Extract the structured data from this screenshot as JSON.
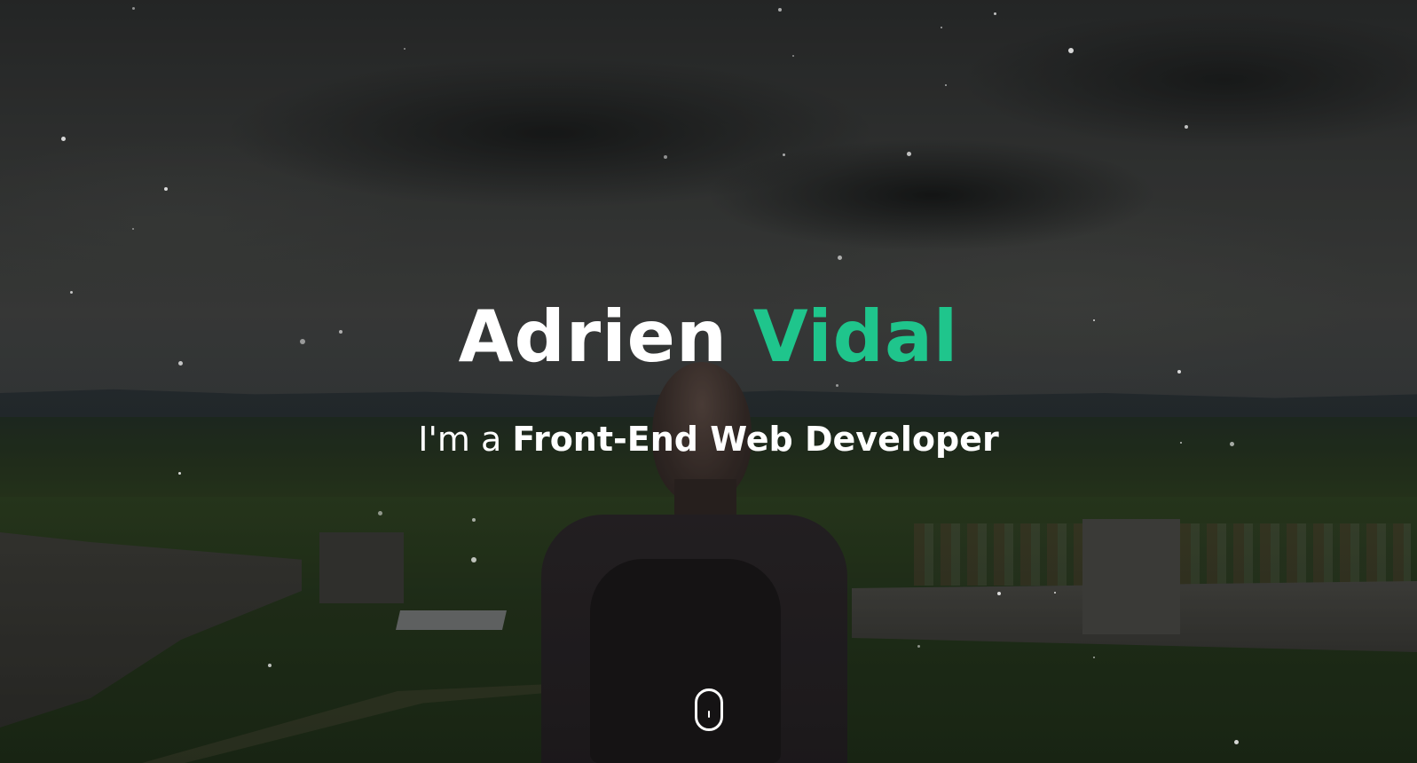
{
  "hero": {
    "first_name": "Adrien",
    "last_name": "Vidal",
    "tagline_prefix": "I'm a",
    "tagline_role": "Front-End Web Developer",
    "accent_color": "#1fc58c",
    "scroll_icon": "mouse-scroll-icon"
  }
}
